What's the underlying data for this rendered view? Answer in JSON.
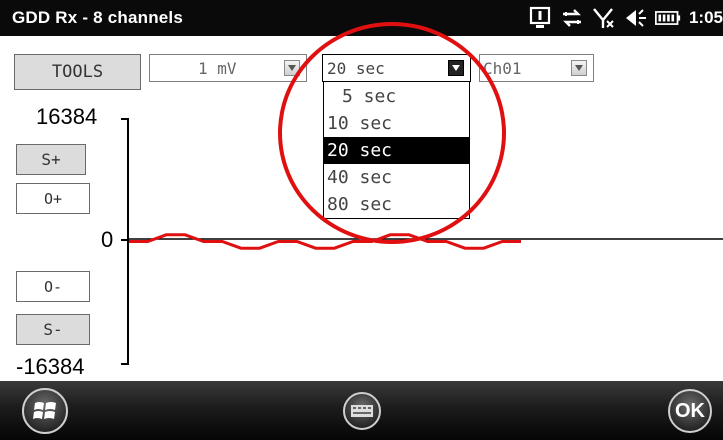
{
  "titlebar": {
    "title": "GDD Rx - 8 channels",
    "clock": "1:05",
    "icons": [
      "keyboard-info-icon",
      "sync-arrows-icon",
      "signal-off-icon",
      "volume-icon",
      "battery-icon"
    ]
  },
  "toolbar": {
    "tools_label": "TOOLS",
    "gain_value": "1 mV",
    "time_value": "20 sec",
    "channel_value": "Ch01"
  },
  "time_dropdown": {
    "options": [
      "5 sec",
      "10 sec",
      "20 sec",
      "40 sec",
      "80 sec"
    ],
    "selected": "20 sec"
  },
  "scale": {
    "max_label": "16384",
    "zero_label": "0",
    "min_label": "-16384"
  },
  "side_buttons": {
    "s_plus": "S+",
    "o_plus": "O+",
    "o_minus": "O-",
    "s_minus": "S-"
  },
  "bottombar": {
    "ok_label": "OK"
  },
  "signal": {
    "color": "#e01010",
    "axis_range": [
      -16384,
      16384
    ],
    "trace_levels": [
      0,
      0,
      900,
      900,
      0,
      0,
      -900,
      -900,
      0,
      0,
      -900,
      -900,
      0,
      0,
      900,
      900,
      0,
      0,
      -900,
      -900,
      0,
      0
    ]
  },
  "colors": {
    "accent_red": "#e01010",
    "selection": "#000000"
  }
}
